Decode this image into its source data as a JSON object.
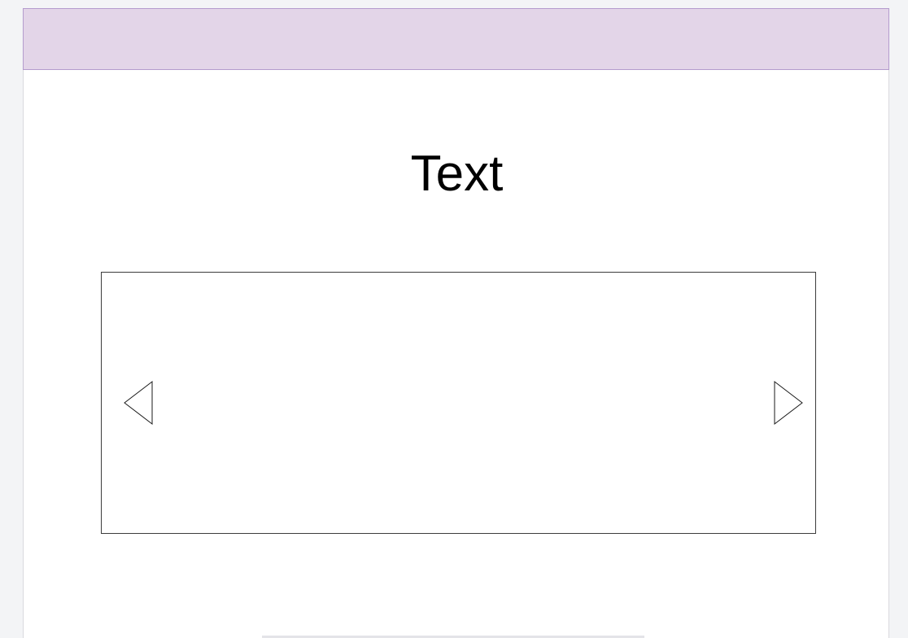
{
  "header": {
    "background_color": "#e3d5e8",
    "border_color": "#b49ccd"
  },
  "main": {
    "heading": "Text"
  },
  "carousel": {
    "prev_icon": "chevron-left-triangle-icon",
    "next_icon": "chevron-right-triangle-icon"
  }
}
